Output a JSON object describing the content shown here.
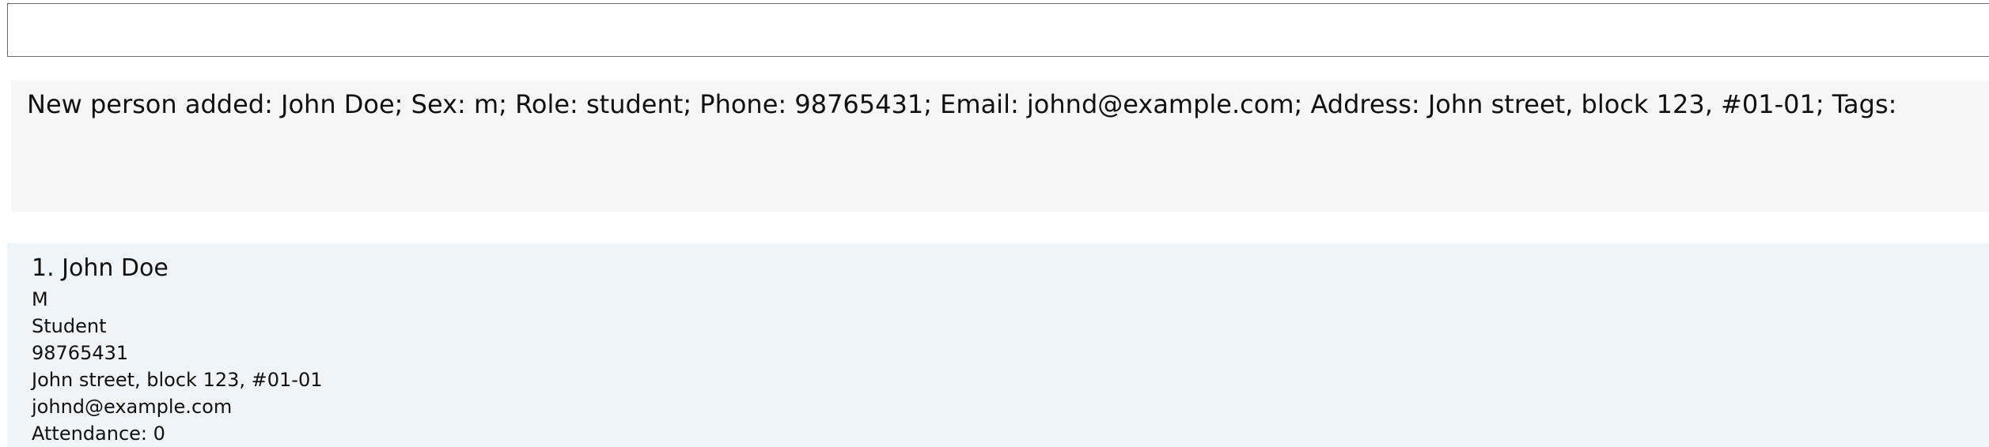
{
  "command_box": {
    "value": ""
  },
  "result_display": {
    "text": "New person added: John Doe; Sex: m; Role: student; Phone: 98765431; Email: johnd@example.com; Address: John street, block 123, #01-01; Tags:"
  },
  "person_list": {
    "items": [
      {
        "index_name": "1. John Doe",
        "sex": "M",
        "role": "Student",
        "phone": "98765431",
        "address": "John street, block 123, #01-01",
        "email": "johnd@example.com",
        "attendance": "Attendance: 0"
      }
    ]
  },
  "colors": {
    "result_background": "#f6f6f6",
    "list_background": "#eff4f8",
    "command_border": "#6d6d6d"
  }
}
